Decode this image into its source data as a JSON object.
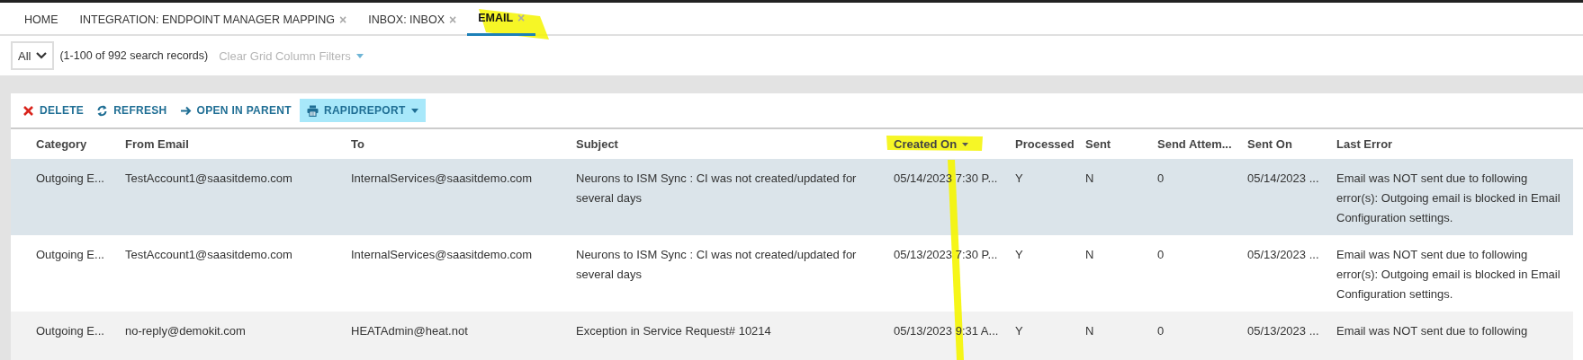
{
  "tabs": [
    {
      "label": "HOME",
      "selected": false
    },
    {
      "label": "INTEGRATION: ENDPOINT MANAGER MAPPING",
      "close": "×",
      "selected": false
    },
    {
      "label": "INBOX: INBOX",
      "close": "×",
      "selected": false
    },
    {
      "label": "EMAIL",
      "close": "×",
      "selected": true
    }
  ],
  "filter": {
    "select": "All",
    "records": "(1-100 of 992 search records)",
    "clear_filters": {
      "label": "Clear Grid Column Filters",
      "disabled": true
    }
  },
  "toolbar": [
    {
      "kind": "delete",
      "label": "DELETE"
    },
    {
      "kind": "refresh",
      "label": "REFRESH"
    },
    {
      "kind": "open",
      "label": "OPEN IN PARENT"
    },
    {
      "kind": "report",
      "label": "RAPIDREPORT",
      "dropdown": true
    }
  ],
  "table": {
    "columns": [
      {
        "label": "Category",
        "sorted": false
      },
      {
        "label": "From Email",
        "sorted": false
      },
      {
        "label": "To",
        "sorted": false
      },
      {
        "label": "Subject",
        "sorted": false
      },
      {
        "label": "Created On",
        "sorted": true
      },
      {
        "label": "Processed",
        "sorted": false
      },
      {
        "label": "Sent",
        "sorted": false
      },
      {
        "label": "Send Attem...",
        "sorted": false
      },
      {
        "label": "Sent On",
        "sorted": false
      },
      {
        "label": "Last Error",
        "sorted": false
      }
    ],
    "rows": [
      {
        "selected": true,
        "cells": [
          "Outgoing E...",
          "TestAccount1@saasitdemo.com",
          "InternalServices@saasitdemo.com",
          "Neurons to ISM Sync : CI was not created/updated for several days",
          "05/14/2023 7:30 P...",
          "Y",
          "N",
          "0",
          "05/14/2023 ...",
          "Email was NOT sent due to following error(s): Outgoing email is blocked in Email Configuration settings."
        ]
      },
      {
        "selected": false,
        "cells": [
          "Outgoing E...",
          "TestAccount1@saasitdemo.com",
          "InternalServices@saasitdemo.com",
          "Neurons to ISM Sync : CI was not created/updated for several days",
          "05/13/2023 7:30 P...",
          "Y",
          "N",
          "0",
          "05/13/2023 ...",
          "Email was NOT sent due to following error(s): Outgoing email is blocked in Email Configuration settings."
        ]
      },
      {
        "selected": false,
        "cells": [
          "Outgoing E...",
          "no-reply@demokit.com",
          "HEATAdmin@heat.not",
          "Exception in Service Request# 10214",
          "05/13/2023 9:31 A...",
          "Y",
          "N",
          "0",
          "05/13/2023 ...",
          "Email was NOT sent due to following"
        ]
      }
    ]
  }
}
